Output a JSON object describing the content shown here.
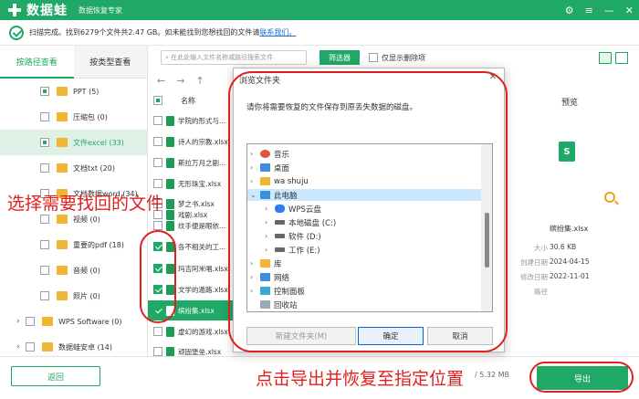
{
  "titlebar": {
    "brand": "数据蛙",
    "subtitle": "数据恢复专家",
    "icons": [
      "settings-icon",
      "menu-icon",
      "minimize-icon",
      "close-icon"
    ]
  },
  "status": {
    "text": "扫描完成。找到6279个文件共2.47 GB。如未能找到您想找回的文件请",
    "link": "联系我们。"
  },
  "left_tabs": [
    "按路径查看",
    "按类型查看"
  ],
  "tree": [
    {
      "label": "PPT (5)"
    },
    {
      "label": "压缩包 (0)"
    },
    {
      "label": "文件excel (33)"
    },
    {
      "label": "文档txt (20)"
    },
    {
      "label": "文档数据word (34)"
    },
    {
      "label": "视频 (0)"
    },
    {
      "label": "重要的pdf (18)"
    },
    {
      "label": "音频 (0)"
    },
    {
      "label": "照片 (0)"
    },
    {
      "label": "WPS Software (0)"
    },
    {
      "label": "数据蛙安卓 (14)"
    }
  ],
  "toolbar": {
    "search_placeholder": "在此处输入文件名称或路径搜索文件",
    "filter": "筛选器",
    "only_deleted": "仅显示删除项"
  },
  "list": {
    "header": "名称",
    "files": [
      "学院的形式与...",
      "诗人的宗教.xlsx",
      "斯拉万月之剧...",
      "无形珠宝.xlsx",
      "梦之书.xlsx",
      "戏剧.xlsx",
      "纹手便是眼依...",
      "各不相关的工...",
      "玛吉阿米唱.xlsx",
      "文学的遁路.xlsx",
      "缤纷集.xlsx",
      "虚幻的游戏.xlsx",
      "顽固堡垒.xlsx"
    ]
  },
  "preview": {
    "title": "预览",
    "filename": "缤纷集.xlsx",
    "fields": [
      {
        "k": "大小",
        "v": "30.6 KB"
      },
      {
        "k": "创建日期",
        "v": "2024-04-15"
      },
      {
        "k": "修改日期",
        "v": "2022-11-01"
      },
      {
        "k": "路径",
        "v": ""
      }
    ]
  },
  "dialog": {
    "title": "浏览文件夹",
    "message": "请你将需要恢复的文件保存到原丢失数据的磁盘。",
    "tree": [
      "音乐",
      "桌面",
      "wa shuju",
      "此电脑",
      "WPS云盘",
      "本地磁盘 (C:)",
      "软件 (D:)",
      "工作 (E:)",
      "库",
      "网络",
      "控制面板",
      "回收站"
    ],
    "new_folder": "新建文件夹(M)",
    "ok": "确定",
    "cancel": "取消"
  },
  "bottom": {
    "back": "返回",
    "info": "/ 5.32 MB",
    "export": "导出"
  },
  "annotations": {
    "left": "选择需要找回的文件",
    "bottom": "点击导出并恢复至指定位置"
  },
  "colors": {
    "brand_green": "#1fa866",
    "annotation_red": "#e02020"
  }
}
